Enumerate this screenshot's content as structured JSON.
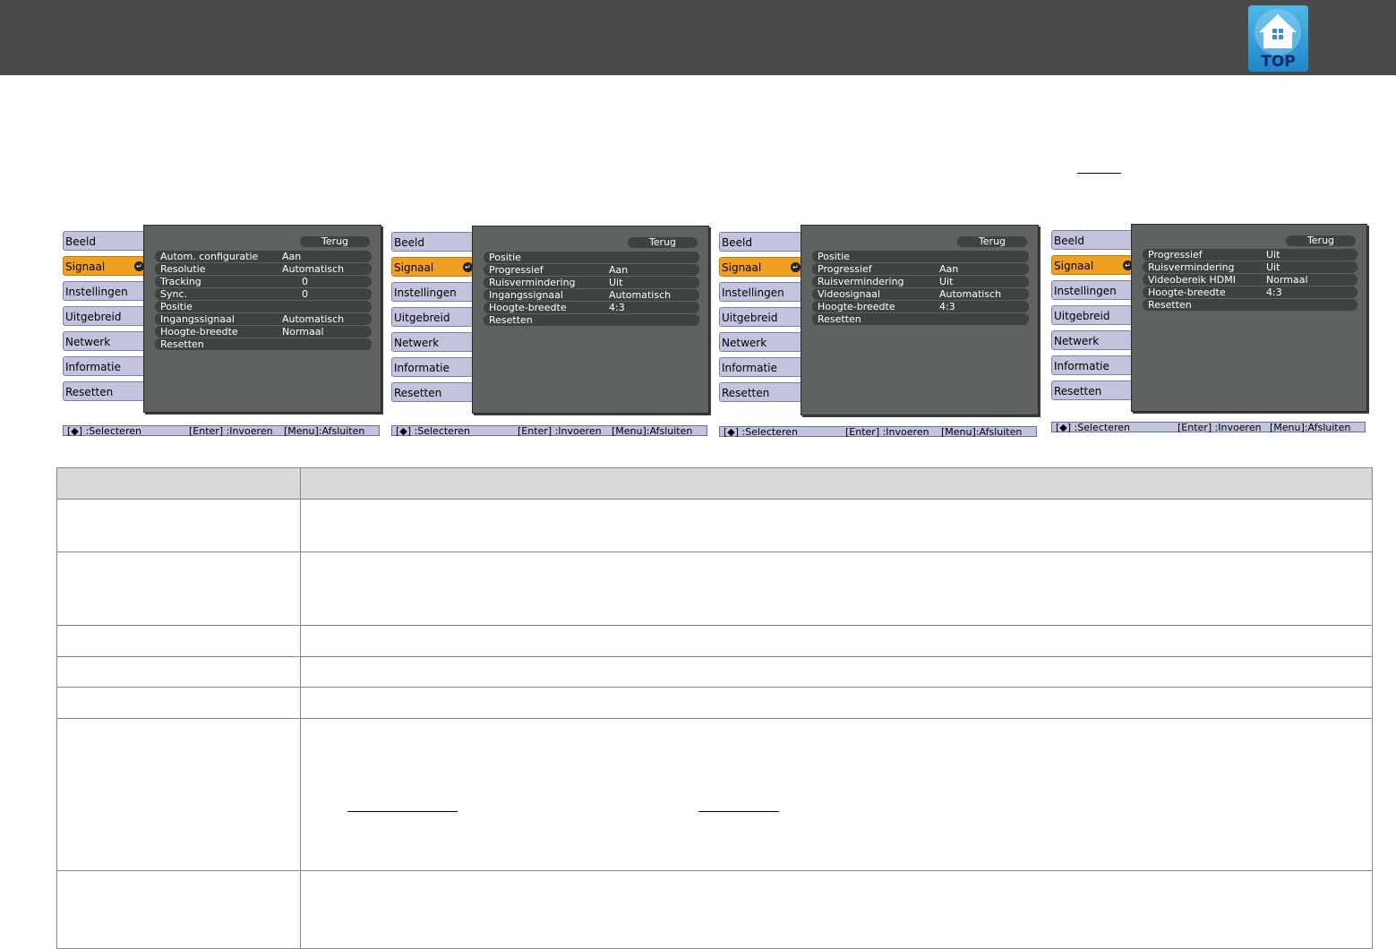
{
  "header": {
    "top_button_label": "TOP",
    "top_button_icon": "house-icon"
  },
  "menus": [
    {
      "sidebar": [
        "Beeld",
        "Signaal",
        "Instellingen",
        "Uitgebreid",
        "Netwerk",
        "Informatie",
        "Resetten"
      ],
      "active_index": 1,
      "back_label": "Terug",
      "rows": [
        {
          "label": "Autom. configuratie",
          "value": "Aan"
        },
        {
          "label": "Resolutie",
          "value": "Automatisch"
        },
        {
          "label": "Tracking",
          "value": "0"
        },
        {
          "label": "Sync.",
          "value": "0"
        },
        {
          "label": "Positie",
          "value": ""
        },
        {
          "label": "Ingangssignaal",
          "value": "Automatisch"
        },
        {
          "label": "Hoogte-breedte",
          "value": "Normaal"
        },
        {
          "label": "Resetten",
          "value": ""
        }
      ],
      "hint": {
        "select": "[◆] :Selecteren",
        "enter": "[Enter] :Invoeren",
        "exit": "[Menu]:Afsluiten"
      }
    },
    {
      "sidebar": [
        "Beeld",
        "Signaal",
        "Instellingen",
        "Uitgebreid",
        "Netwerk",
        "Informatie",
        "Resetten"
      ],
      "active_index": 1,
      "back_label": "Terug",
      "rows": [
        {
          "label": "Positie",
          "value": ""
        },
        {
          "label": "Progressief",
          "value": "Aan"
        },
        {
          "label": "Ruisvermindering",
          "value": "Uit"
        },
        {
          "label": "Ingangssignaal",
          "value": "Automatisch"
        },
        {
          "label": "Hoogte-breedte",
          "value": "4:3"
        },
        {
          "label": "Resetten",
          "value": ""
        }
      ],
      "hint": {
        "select": "[◆] :Selecteren",
        "enter": "[Enter] :Invoeren",
        "exit": "[Menu]:Afsluiten"
      }
    },
    {
      "sidebar": [
        "Beeld",
        "Signaal",
        "Instellingen",
        "Uitgebreid",
        "Netwerk",
        "Informatie",
        "Resetten"
      ],
      "active_index": 1,
      "back_label": "Terug",
      "rows": [
        {
          "label": "Positie",
          "value": ""
        },
        {
          "label": "Progressief",
          "value": "Aan"
        },
        {
          "label": "Ruisvermindering",
          "value": "Uit"
        },
        {
          "label": "Videosignaal",
          "value": "Automatisch"
        },
        {
          "label": "Hoogte-breedte",
          "value": "4:3"
        },
        {
          "label": "Resetten",
          "value": ""
        }
      ],
      "hint": {
        "select": "[◆] :Selecteren",
        "enter": "[Enter] :Invoeren",
        "exit": "[Menu]:Afsluiten"
      }
    },
    {
      "sidebar": [
        "Beeld",
        "Signaal",
        "Instellingen",
        "Uitgebreid",
        "Netwerk",
        "Informatie",
        "Resetten"
      ],
      "active_index": 1,
      "back_label": "Terug",
      "rows": [
        {
          "label": "Progressief",
          "value": "Uit"
        },
        {
          "label": "Ruisvermindering",
          "value": "Uit"
        },
        {
          "label": "Videobereik HDMI",
          "value": "Normaal"
        },
        {
          "label": "Hoogte-breedte",
          "value": "4:3"
        },
        {
          "label": "Resetten",
          "value": ""
        }
      ],
      "hint": {
        "select": "[◆] :Selecteren",
        "enter": "[Enter] :Invoeren",
        "exit": "[Menu]:Afsluiten"
      }
    }
  ]
}
